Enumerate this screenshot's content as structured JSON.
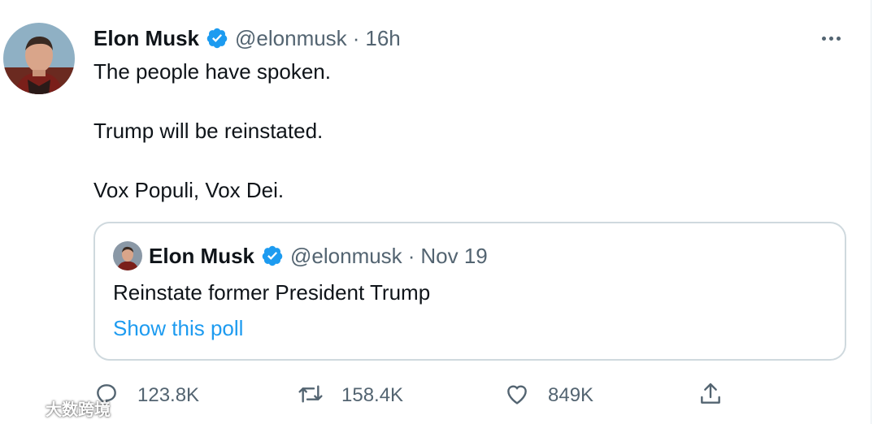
{
  "tweet": {
    "author_name": "Elon Musk",
    "handle": "@elonmusk",
    "separator": "·",
    "time": "16h",
    "lines": [
      "The people have spoken.",
      "Trump will be reinstated.",
      "Vox Populi, Vox Dei."
    ]
  },
  "quoted": {
    "author_name": "Elon Musk",
    "handle": "@elonmusk",
    "separator": "·",
    "date": "Nov 19",
    "text": "Reinstate former President Trump",
    "link_text": "Show this poll"
  },
  "actions": {
    "replies": "123.8K",
    "retweets": "158.4K",
    "likes": "849K"
  },
  "watermark": {
    "text": "大数跨境"
  },
  "colors": {
    "verified": "#1d9bf0",
    "link": "#1d9bf0",
    "secondary_text": "#536471",
    "border": "#cfd9de"
  },
  "icons": [
    "verified-badge-icon",
    "more-options-icon",
    "reply-icon",
    "retweet-icon",
    "like-icon",
    "share-icon"
  ]
}
